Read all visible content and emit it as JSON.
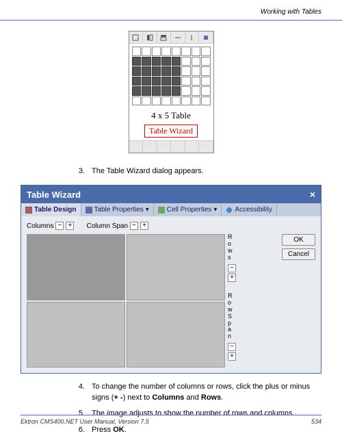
{
  "header": {
    "section_title": "Working with Tables"
  },
  "picker": {
    "size_label": "4 x 5 Table",
    "wizard_link": "Table Wizard"
  },
  "steps": {
    "s3": {
      "num": "3.",
      "text": "The Table Wizard dialog appears."
    },
    "s4": {
      "num": "4.",
      "text_a": "To change the number of columns or rows, click the plus or minus signs (",
      "text_b": "+ -",
      "text_c": ") next to ",
      "text_d": "Columns",
      "text_e": " and ",
      "text_f": "Rows",
      "text_g": "."
    },
    "s5": {
      "num": "5.",
      "text": "The image adjusts to show the number of rows and columns."
    },
    "s6": {
      "num": "6.",
      "text_a": "Press ",
      "text_b": "OK",
      "text_c": "."
    }
  },
  "wizard": {
    "title": "Table Wizard",
    "tabs": {
      "design": "Table Design",
      "properties": "Table Properties",
      "cell": "Cell Properties",
      "accessibility": "Accessibility"
    },
    "columns_label": "Columns",
    "colspan_label": "Column Span",
    "rows_label": "Rows",
    "rowspan_label": "RowSpan",
    "minus": "−",
    "plus": "+",
    "ok": "OK",
    "cancel": "Cancel"
  },
  "footer": {
    "manual": "Ektron CMS400.NET User Manual, Version 7.5",
    "page": "534"
  }
}
